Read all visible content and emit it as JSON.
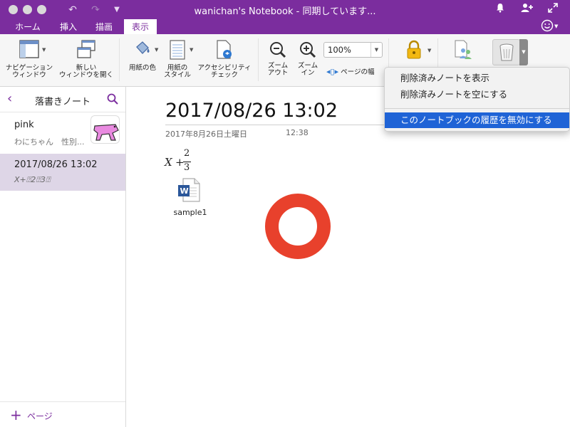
{
  "window": {
    "title": "wanichan's Notebook - 同期しています..."
  },
  "tabs": [
    {
      "label": "ホーム"
    },
    {
      "label": "挿入"
    },
    {
      "label": "描画"
    },
    {
      "label": "表示"
    }
  ],
  "ribbon": {
    "nav_window": "ナビゲーション\nウィンドウ",
    "new_window": "新しい\nウィンドウを開く",
    "paper_color": "用紙の色",
    "paper_style": "用紙の\nスタイル",
    "accessibility": "アクセシビリティ\nチェック",
    "zoom_out": "ズーム\nアウト",
    "zoom_in": "ズーム\nイン",
    "zoom_value": "100%",
    "page_width": "ページの幅"
  },
  "sidebar": {
    "section_title": "落書きノート",
    "pages": [
      {
        "title": "pink",
        "preview": "わにちゃん　性別..."
      },
      {
        "title": "2017/08/26 13:02",
        "preview": "X+⍰2⍰3⍰"
      }
    ],
    "add_page": "ページ"
  },
  "note": {
    "title": "2017/08/26 13:02",
    "date": "2017年8月26日土曜日",
    "time": "12:38",
    "math_var": "X",
    "math_op": "+",
    "math_num": "2",
    "math_den": "3",
    "attachment_name": "sample1"
  },
  "menu": {
    "items": [
      {
        "label": "削除済みノートを表示"
      },
      {
        "label": "削除済みノートを空にする"
      },
      {
        "label": "このノートブックの履歴を無効にする"
      }
    ]
  },
  "colors": {
    "brand_purple": "#7b2d9e",
    "selection_blue": "#1f63d6",
    "ring_red": "#e8412c"
  }
}
